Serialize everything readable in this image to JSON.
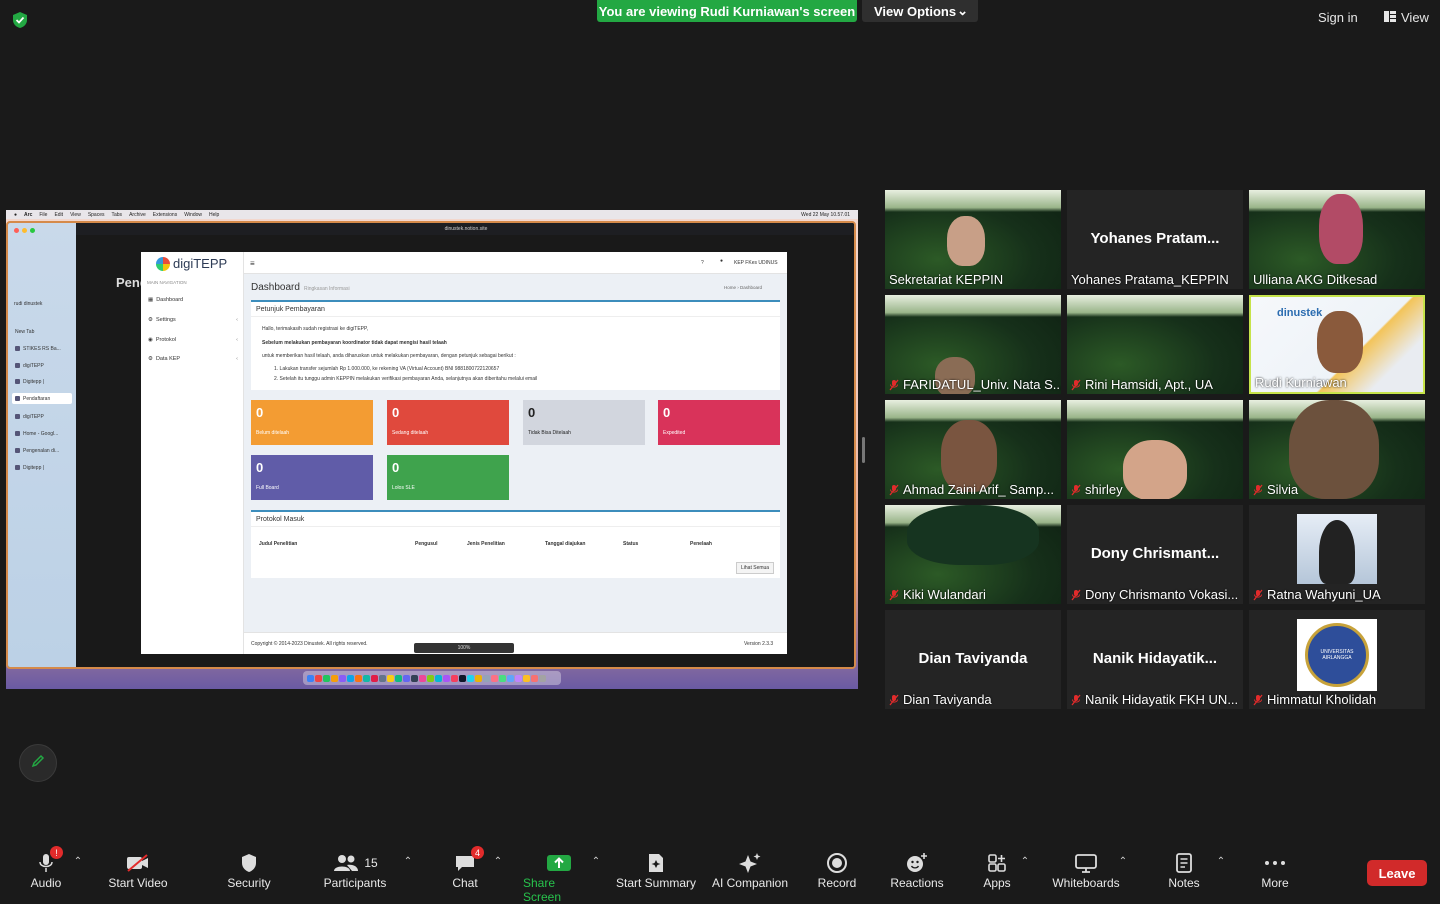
{
  "top": {
    "viewing_banner": "You are viewing Rudi Kurniawan's screen",
    "view_options": "View Options",
    "sign_in": "Sign in",
    "view": "View"
  },
  "shared_screen": {
    "menubar": [
      "Arc",
      "File",
      "Edit",
      "View",
      "Spaces",
      "Tabs",
      "Archive",
      "Extensions",
      "Window",
      "Help"
    ],
    "clock": "Wed 22 May 10.57.01",
    "url": "dinustek.notion.site",
    "arc_tabs": [
      "rudi dinustek",
      "New Tab",
      "STIKES RS Ba...",
      "digiTEPP",
      "Digitepp |",
      "Pendaftaran",
      "digiTEPP",
      "Home - Googl...",
      "Pengenalan di...",
      "Digitepp |"
    ],
    "notion_title": "Pend",
    "app": {
      "logo": "digiTEPP",
      "nav_header": "MAIN NAVIGATION",
      "nav": [
        "Dashboard",
        "Settings",
        "Protokol",
        "Data KEP"
      ],
      "help": "?",
      "user": "KEP FKes UDINUS",
      "page_title": "Dashboard",
      "page_sub": "Ringkasan Informasi",
      "crumb": "Home  ›  Dashboard",
      "petunjuk": {
        "title": "Petunjuk Pembayaran",
        "greeting": "Hallo, terimakasih sudah registrasi ke digiTEPP,",
        "warning": "Sebelum melakukan pembayaran koordinator tidak dapat mengisi hasil telaah",
        "intro": "untuk memberikan hasil telaah, anda diharuskan untuk melakukan pembayaran, dengan petunjuk sebagai berikut :",
        "step1": "1. Lakukan transfer sejumlah Rp 1.000.000, ke rekening VA (Virtual Account) BNI 9881800722120657",
        "step2": "2. Setelah itu tunggu admin KEPPIN melakukan verifikasi pembayaran Anda, selanjutnya akan diberitahu melalui email"
      },
      "tiles": [
        {
          "value": "0",
          "label": "Belum ditelaah",
          "color": "#f39c33"
        },
        {
          "value": "0",
          "label": "Sedang ditelaah",
          "color": "#e0493d"
        },
        {
          "value": "0",
          "label": "Tidak Bisa Ditelaah",
          "color": "#d2d6de"
        },
        {
          "value": "0",
          "label": "Expedited",
          "color": "#d9335a"
        },
        {
          "value": "0",
          "label": "Full Board",
          "color": "#605ca8"
        },
        {
          "value": "0",
          "label": "Lolos SLE",
          "color": "#3fa34d"
        }
      ],
      "protokol": {
        "title": "Protokol Masuk",
        "columns": [
          "Judul Penelitian",
          "Pengusul",
          "Jenis Penelitian",
          "Tanggal diajukan",
          "Status",
          "Penelaah"
        ],
        "see_all": "Lihat Semua"
      },
      "footer_left": "Copyright © 2014-2023 Dinustek. All rights reserved.",
      "footer_right": "Version 2.3.3",
      "zoom": "100%"
    }
  },
  "participants": [
    {
      "display": "Sekretariat KEPPIN",
      "big": "",
      "muted": false
    },
    {
      "display": "Yohanes Pratama_KEPPIN",
      "big": "Yohanes  Pratam...",
      "muted": false
    },
    {
      "display": "Ulliana AKG Ditkesad",
      "big": "",
      "muted": false
    },
    {
      "display": "FARIDATUL_Univ. Nata S...",
      "big": "",
      "muted": true
    },
    {
      "display": "Rini Hamsidi, Apt., UA",
      "big": "",
      "muted": true
    },
    {
      "display": "Rudi Kurniawan",
      "big": "",
      "muted": false
    },
    {
      "display": "Ahmad Zaini Arif_ Samp...",
      "big": "",
      "muted": true
    },
    {
      "display": "shirley",
      "big": "",
      "muted": true
    },
    {
      "display": "Silvia",
      "big": "",
      "muted": true
    },
    {
      "display": "Kiki Wulandari",
      "big": "",
      "muted": true
    },
    {
      "display": "Dony Chrismanto Vokasi...",
      "big": "Dony  Chrismant...",
      "muted": true
    },
    {
      "display": "Ratna Wahyuni_UA",
      "big": "",
      "muted": true
    },
    {
      "display": "Dian Taviyanda",
      "big": "Dian  Taviyanda",
      "muted": true
    },
    {
      "display": "Nanik Hidayatik FKH UN...",
      "big": "Nanik  Hidayatik...",
      "muted": true
    },
    {
      "display": "Himmatul Kholidah",
      "big": "",
      "muted": true
    }
  ],
  "seal_text": "UNIVERSITAS AIRLANGGA",
  "dinustek_logo": "dinustek",
  "toolbar": {
    "audio": "Audio",
    "audio_badge": "!",
    "start_video": "Start Video",
    "security": "Security",
    "participants": "Participants",
    "participants_count": "15",
    "chat": "Chat",
    "chat_badge": "4",
    "share_screen": "Share Screen",
    "start_summary": "Start Summary",
    "ai_companion": "AI Companion",
    "record": "Record",
    "reactions": "Reactions",
    "apps": "Apps",
    "whiteboards": "Whiteboards",
    "notes": "Notes",
    "more": "More",
    "leave": "Leave"
  }
}
